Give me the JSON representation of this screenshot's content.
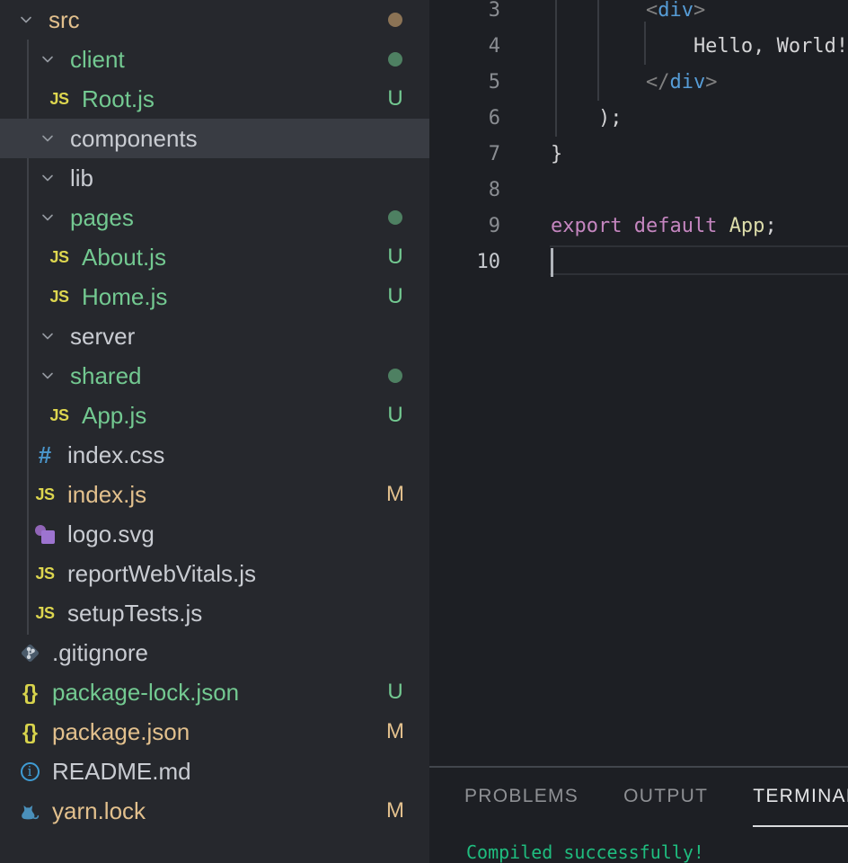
{
  "colors": {
    "untracked_green": "#73c991",
    "modified_tan": "#e2c08d",
    "selection_bg": "#393c43",
    "terminal_green": "#1fbd7f",
    "tag_blue": "#569cd6",
    "keyword_pink": "#c586c0",
    "function_yellow": "#dcdcaa",
    "punctuation_gray": "#808080",
    "plain_text": "#d4d4d6"
  },
  "explorer": {
    "items": [
      {
        "label": "src",
        "kind": "folder",
        "depth": 0,
        "color": "tan",
        "badge": "dot-tan",
        "icon": "chevron-down"
      },
      {
        "label": "client",
        "kind": "folder",
        "depth": 1,
        "color": "green",
        "badge": "dot-green",
        "icon": "chevron-down"
      },
      {
        "label": "Root.js",
        "kind": "file",
        "depth": 2,
        "color": "green",
        "badge": "U",
        "icon": "js"
      },
      {
        "label": "components",
        "kind": "folder",
        "depth": 1,
        "color": "default",
        "badge": null,
        "icon": "chevron-down",
        "selected": true
      },
      {
        "label": "lib",
        "kind": "folder",
        "depth": 1,
        "color": "default",
        "badge": null,
        "icon": "chevron-down"
      },
      {
        "label": "pages",
        "kind": "folder",
        "depth": 1,
        "color": "green",
        "badge": "dot-green",
        "icon": "chevron-down"
      },
      {
        "label": "About.js",
        "kind": "file",
        "depth": 2,
        "color": "green",
        "badge": "U",
        "icon": "js"
      },
      {
        "label": "Home.js",
        "kind": "file",
        "depth": 2,
        "color": "green",
        "badge": "U",
        "icon": "js"
      },
      {
        "label": "server",
        "kind": "folder",
        "depth": 1,
        "color": "default",
        "badge": null,
        "icon": "chevron-down"
      },
      {
        "label": "shared",
        "kind": "folder",
        "depth": 1,
        "color": "green",
        "badge": "dot-green",
        "icon": "chevron-down"
      },
      {
        "label": "App.js",
        "kind": "file",
        "depth": 2,
        "color": "green",
        "badge": "U",
        "icon": "js"
      },
      {
        "label": "index.css",
        "kind": "file",
        "depth": 1,
        "color": "default",
        "badge": null,
        "icon": "css"
      },
      {
        "label": "index.js",
        "kind": "file",
        "depth": 1,
        "color": "tan",
        "badge": "M",
        "icon": "js"
      },
      {
        "label": "logo.svg",
        "kind": "file",
        "depth": 1,
        "color": "default",
        "badge": null,
        "icon": "svg"
      },
      {
        "label": "reportWebVitals.js",
        "kind": "file",
        "depth": 1,
        "color": "default",
        "badge": null,
        "icon": "js"
      },
      {
        "label": "setupTests.js",
        "kind": "file",
        "depth": 1,
        "color": "default",
        "badge": null,
        "icon": "js"
      },
      {
        "label": ".gitignore",
        "kind": "file",
        "depth": 0,
        "color": "default",
        "badge": null,
        "icon": "git"
      },
      {
        "label": "package-lock.json",
        "kind": "file",
        "depth": 0,
        "color": "green",
        "badge": "U",
        "icon": "json"
      },
      {
        "label": "package.json",
        "kind": "file",
        "depth": 0,
        "color": "tan",
        "badge": "M",
        "icon": "json"
      },
      {
        "label": "README.md",
        "kind": "file",
        "depth": 0,
        "color": "default",
        "badge": null,
        "icon": "info"
      },
      {
        "label": "yarn.lock",
        "kind": "file",
        "depth": 0,
        "color": "tan",
        "badge": "M",
        "icon": "yarn"
      }
    ]
  },
  "editor": {
    "lines": [
      {
        "num": "3",
        "tokens": [
          {
            "t": "        <",
            "c": "punct"
          },
          {
            "t": "div",
            "c": "tag"
          },
          {
            "t": ">",
            "c": "punct"
          }
        ]
      },
      {
        "num": "4",
        "tokens": [
          {
            "t": "            Hello, World!",
            "c": "plain"
          }
        ]
      },
      {
        "num": "5",
        "tokens": [
          {
            "t": "        </",
            "c": "punct"
          },
          {
            "t": "div",
            "c": "tag"
          },
          {
            "t": ">",
            "c": "punct"
          }
        ]
      },
      {
        "num": "6",
        "tokens": [
          {
            "t": "    );",
            "c": "plain"
          }
        ]
      },
      {
        "num": "7",
        "tokens": [
          {
            "t": "}",
            "c": "plain"
          }
        ]
      },
      {
        "num": "8",
        "tokens": []
      },
      {
        "num": "9",
        "tokens": [
          {
            "t": "export default",
            "c": "keyword"
          },
          {
            "t": " ",
            "c": "plain"
          },
          {
            "t": "App",
            "c": "function"
          },
          {
            "t": ";",
            "c": "plain"
          }
        ]
      },
      {
        "num": "10",
        "tokens": [],
        "active": true
      }
    ]
  },
  "panel": {
    "tabs": [
      {
        "label": "PROBLEMS",
        "active": false
      },
      {
        "label": "OUTPUT",
        "active": false
      },
      {
        "label": "TERMINAL",
        "active": true
      }
    ],
    "terminal_output": "Compiled successfully!"
  }
}
